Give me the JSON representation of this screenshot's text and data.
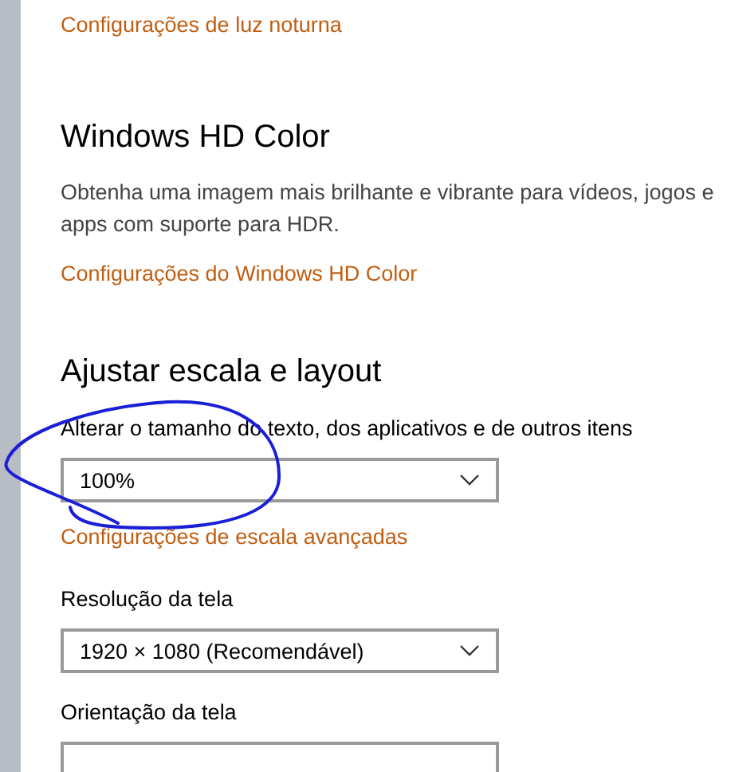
{
  "sections": [
    {
      "kind": "link",
      "text": "Configurações de luz noturna"
    },
    {
      "kind": "heading",
      "text": "Windows HD Color"
    },
    {
      "kind": "paragraph",
      "text": "Obtenha uma imagem mais brilhante e vibrante para vídeos, jogos e apps com suporte para HDR."
    },
    {
      "kind": "link",
      "text": "Configurações do Windows HD Color"
    },
    {
      "kind": "heading",
      "text": "Ajustar escala e layout"
    },
    {
      "kind": "label",
      "text": "Alterar o tamanho do texto, dos aplicativos e de outros itens"
    },
    {
      "kind": "dropdown",
      "value": "100%"
    },
    {
      "kind": "link",
      "text": "Configurações de escala avançadas"
    },
    {
      "kind": "label",
      "text": "Resolução da tela"
    },
    {
      "kind": "dropdown",
      "value": "1920 × 1080 (Recomendável)"
    },
    {
      "kind": "label",
      "text": "Orientação da tela"
    },
    {
      "kind": "dropdown-cut"
    }
  ]
}
